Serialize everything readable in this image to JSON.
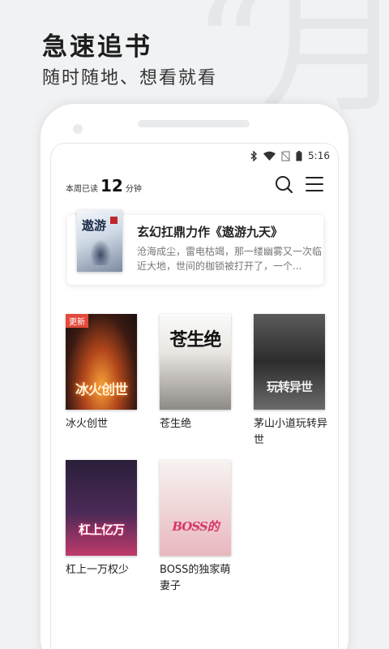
{
  "promo": {
    "headline": "急速追书",
    "subline": "随时随地、想看就看"
  },
  "status_bar": {
    "time": "5:16",
    "icons": [
      "bluetooth-icon",
      "wifi-icon",
      "no-sim-icon",
      "battery-icon"
    ]
  },
  "header": {
    "week_read_prefix": "本周已读",
    "week_read_minutes": "12",
    "week_read_unit": "分钟",
    "icons": [
      "search-icon",
      "menu-icon"
    ]
  },
  "featured": {
    "title": "玄幻扛鼎力作《遨游九天》",
    "description": "沧海成尘，雷电枯竭，那一缕幽雾又一次临近大地，世间的枷锁被打开了，一个...",
    "cover_text": "遨游"
  },
  "books": [
    {
      "title": "冰火创世",
      "badge": "更新",
      "cover_text": "冰火创世"
    },
    {
      "title": "苍生绝",
      "badge": "",
      "cover_text": "苍生绝"
    },
    {
      "title": "茅山小道玩转异世",
      "badge": "",
      "cover_text": "玩转异世"
    },
    {
      "title": "杠上一万权少",
      "badge": "",
      "cover_text": "杠上亿万"
    },
    {
      "title": "BOSS的独家萌妻子",
      "badge": "",
      "cover_text": "BOSS的"
    }
  ],
  "colors": {
    "background": "#f1f2f4",
    "badge": "#e24a3b"
  }
}
